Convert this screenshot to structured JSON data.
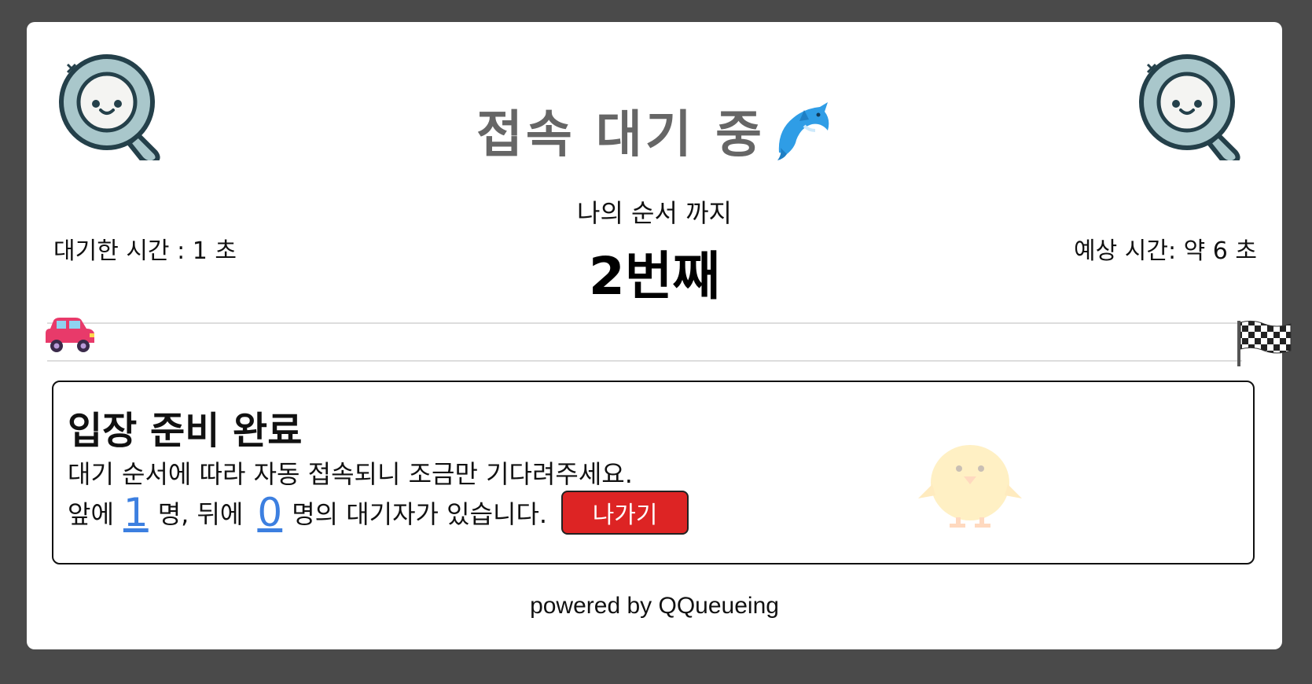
{
  "header": {
    "title": "접속 대기 중",
    "title_emoji": "dolphin-icon"
  },
  "queue": {
    "until_label": "나의 순서 까지",
    "position_text": "2번째",
    "waited_text": "대기한 시간 : 1 초",
    "expected_text": "예상 시간: 약 6 초",
    "progress": 0
  },
  "status": {
    "title": "입장 준비 완료",
    "message": "대기 순서에 따라 자동 접속되니 조금만 기다려주세요.",
    "ahead_prefix": "앞에",
    "ahead_count": "1",
    "ahead_suffix": "명, 뒤에",
    "behind_count": "0",
    "behind_suffix": "명의 대기자가 있습니다.",
    "exit_label": "나가기"
  },
  "footer": {
    "text": "powered by QQueueing"
  },
  "colors": {
    "background": "#4a4a4a",
    "title": "#666666",
    "count": "#3c7fe0",
    "exit_button": "#dd2424"
  }
}
